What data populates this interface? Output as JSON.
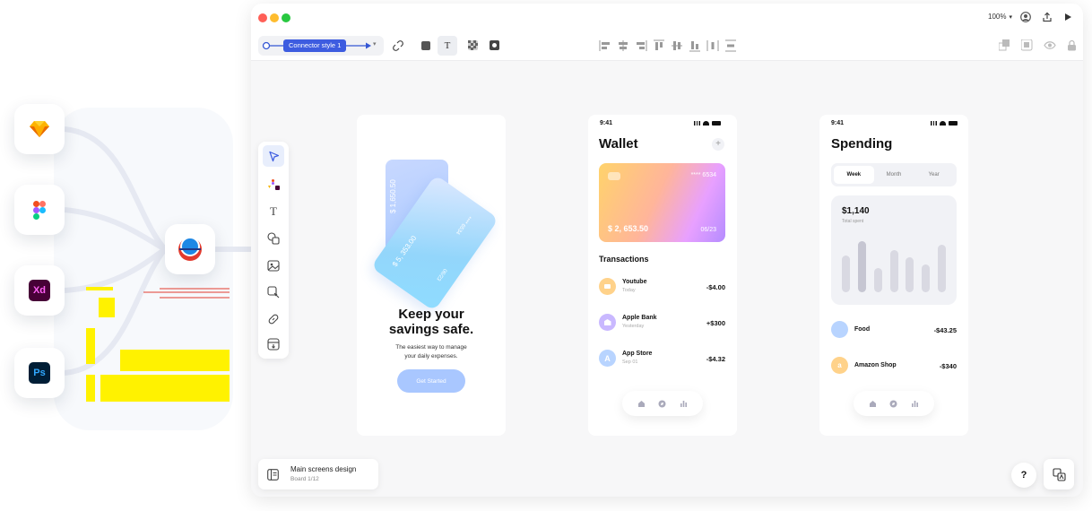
{
  "integrations": {
    "apps": [
      {
        "name": "Sketch",
        "icon": "sketch-icon",
        "color": "#f7b500"
      },
      {
        "name": "Figma",
        "icon": "figma-icon",
        "color": "#a259ff"
      },
      {
        "name": "Adobe XD",
        "label": "Xd",
        "icon": "xd-icon",
        "color": "#ff61f6"
      },
      {
        "name": "Photoshop",
        "label": "Ps",
        "icon": "ps-icon",
        "color": "#31a8ff"
      }
    ],
    "hub_icon": "hub-logo-icon"
  },
  "window": {
    "zoom": "100%",
    "connector_label": "Connector style 1"
  },
  "board": {
    "name": "Main screens design",
    "sub": "Board 1/12"
  },
  "help_label": "?",
  "onboarding": {
    "card_back_amount": "$ 1,650.50",
    "card_back_number": "**** 6534",
    "card_back_expiry": "06/23",
    "card_front_amount": "$ 5, 353.00",
    "headline_line1": "Keep your",
    "headline_line2": "savings safe.",
    "subtitle_line1": "The easiest way to manage",
    "subtitle_line2": "your daily expenses.",
    "cta": "Get Started"
  },
  "wallet": {
    "time": "9:41",
    "title": "Wallet",
    "add": "+",
    "card_number": "**** 6534",
    "card_amount": "$ 2, 653.50",
    "card_expiry": "06/23",
    "transactions_title": "Transactions",
    "transactions": [
      {
        "name": "Youtube",
        "date": "Today",
        "amount": "-$4.00",
        "color": "#ffd28a"
      },
      {
        "name": "Apple Bank",
        "date": "Yesterday",
        "amount": "+$300",
        "color": "#c9b8ff"
      },
      {
        "name": "App Store",
        "date": "Sep 01",
        "amount": "-$4.32",
        "color": "#b8d4ff"
      }
    ]
  },
  "spending": {
    "time": "9:41",
    "title": "Spending",
    "tabs": [
      "Week",
      "Month",
      "Year"
    ],
    "total": "$1,140",
    "total_label": "Total spent",
    "bars": [
      0.68,
      0.95,
      0.45,
      0.78,
      0.65,
      0.52,
      0.88
    ],
    "items": [
      {
        "name": "Food",
        "amount": "-$43.25",
        "color": "#b8d4ff"
      },
      {
        "name": "Amazon Shop",
        "amount": "-$340",
        "color": "#ffd28a"
      }
    ]
  }
}
